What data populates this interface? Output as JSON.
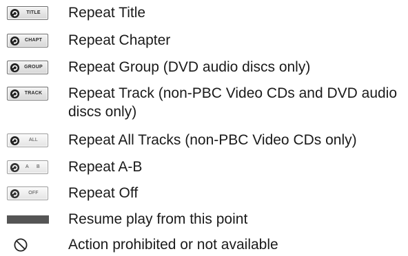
{
  "legend": {
    "items": [
      {
        "icon": "repeat-title-icon",
        "badge_text": "TITLE",
        "label": "Repeat Title"
      },
      {
        "icon": "repeat-chapter-icon",
        "badge_text": "CHAPT",
        "label": "Repeat Chapter"
      },
      {
        "icon": "repeat-group-icon",
        "badge_text": "GROUP",
        "label": "Repeat Group (DVD audio discs only)"
      },
      {
        "icon": "repeat-track-icon",
        "badge_text": "TRACK",
        "label": "Repeat Track (non-PBC Video CDs and DVD audio discs only)"
      },
      {
        "icon": "repeat-all-icon",
        "badge_text": "ALL",
        "label": "Repeat All Tracks (non-PBC Video CDs only)"
      },
      {
        "icon": "repeat-ab-icon",
        "badge_text_a": "A",
        "badge_text_b": "B",
        "label": "Repeat A-B"
      },
      {
        "icon": "repeat-off-icon",
        "badge_text": "OFF",
        "label": "Repeat Off"
      },
      {
        "icon": "resume-bar-icon",
        "label": "Resume play from this point"
      },
      {
        "icon": "prohibited-icon",
        "label": "Action prohibited or not available"
      }
    ],
    "colors": {
      "text": "#1a1a1a",
      "badge_border": "#6b6b6b",
      "bar": "#555555"
    }
  }
}
